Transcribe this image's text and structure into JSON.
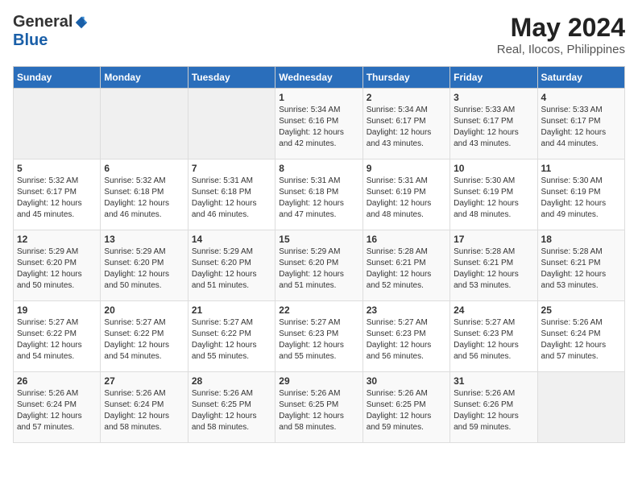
{
  "logo": {
    "general": "General",
    "blue": "Blue"
  },
  "title": "May 2024",
  "location": "Real, Ilocos, Philippines",
  "days_header": [
    "Sunday",
    "Monday",
    "Tuesday",
    "Wednesday",
    "Thursday",
    "Friday",
    "Saturday"
  ],
  "weeks": [
    [
      {
        "num": "",
        "info": ""
      },
      {
        "num": "",
        "info": ""
      },
      {
        "num": "",
        "info": ""
      },
      {
        "num": "1",
        "info": "Sunrise: 5:34 AM\nSunset: 6:16 PM\nDaylight: 12 hours\nand 42 minutes."
      },
      {
        "num": "2",
        "info": "Sunrise: 5:34 AM\nSunset: 6:17 PM\nDaylight: 12 hours\nand 43 minutes."
      },
      {
        "num": "3",
        "info": "Sunrise: 5:33 AM\nSunset: 6:17 PM\nDaylight: 12 hours\nand 43 minutes."
      },
      {
        "num": "4",
        "info": "Sunrise: 5:33 AM\nSunset: 6:17 PM\nDaylight: 12 hours\nand 44 minutes."
      }
    ],
    [
      {
        "num": "5",
        "info": "Sunrise: 5:32 AM\nSunset: 6:17 PM\nDaylight: 12 hours\nand 45 minutes."
      },
      {
        "num": "6",
        "info": "Sunrise: 5:32 AM\nSunset: 6:18 PM\nDaylight: 12 hours\nand 46 minutes."
      },
      {
        "num": "7",
        "info": "Sunrise: 5:31 AM\nSunset: 6:18 PM\nDaylight: 12 hours\nand 46 minutes."
      },
      {
        "num": "8",
        "info": "Sunrise: 5:31 AM\nSunset: 6:18 PM\nDaylight: 12 hours\nand 47 minutes."
      },
      {
        "num": "9",
        "info": "Sunrise: 5:31 AM\nSunset: 6:19 PM\nDaylight: 12 hours\nand 48 minutes."
      },
      {
        "num": "10",
        "info": "Sunrise: 5:30 AM\nSunset: 6:19 PM\nDaylight: 12 hours\nand 48 minutes."
      },
      {
        "num": "11",
        "info": "Sunrise: 5:30 AM\nSunset: 6:19 PM\nDaylight: 12 hours\nand 49 minutes."
      }
    ],
    [
      {
        "num": "12",
        "info": "Sunrise: 5:29 AM\nSunset: 6:20 PM\nDaylight: 12 hours\nand 50 minutes."
      },
      {
        "num": "13",
        "info": "Sunrise: 5:29 AM\nSunset: 6:20 PM\nDaylight: 12 hours\nand 50 minutes."
      },
      {
        "num": "14",
        "info": "Sunrise: 5:29 AM\nSunset: 6:20 PM\nDaylight: 12 hours\nand 51 minutes."
      },
      {
        "num": "15",
        "info": "Sunrise: 5:29 AM\nSunset: 6:20 PM\nDaylight: 12 hours\nand 51 minutes."
      },
      {
        "num": "16",
        "info": "Sunrise: 5:28 AM\nSunset: 6:21 PM\nDaylight: 12 hours\nand 52 minutes."
      },
      {
        "num": "17",
        "info": "Sunrise: 5:28 AM\nSunset: 6:21 PM\nDaylight: 12 hours\nand 53 minutes."
      },
      {
        "num": "18",
        "info": "Sunrise: 5:28 AM\nSunset: 6:21 PM\nDaylight: 12 hours\nand 53 minutes."
      }
    ],
    [
      {
        "num": "19",
        "info": "Sunrise: 5:27 AM\nSunset: 6:22 PM\nDaylight: 12 hours\nand 54 minutes."
      },
      {
        "num": "20",
        "info": "Sunrise: 5:27 AM\nSunset: 6:22 PM\nDaylight: 12 hours\nand 54 minutes."
      },
      {
        "num": "21",
        "info": "Sunrise: 5:27 AM\nSunset: 6:22 PM\nDaylight: 12 hours\nand 55 minutes."
      },
      {
        "num": "22",
        "info": "Sunrise: 5:27 AM\nSunset: 6:23 PM\nDaylight: 12 hours\nand 55 minutes."
      },
      {
        "num": "23",
        "info": "Sunrise: 5:27 AM\nSunset: 6:23 PM\nDaylight: 12 hours\nand 56 minutes."
      },
      {
        "num": "24",
        "info": "Sunrise: 5:27 AM\nSunset: 6:23 PM\nDaylight: 12 hours\nand 56 minutes."
      },
      {
        "num": "25",
        "info": "Sunrise: 5:26 AM\nSunset: 6:24 PM\nDaylight: 12 hours\nand 57 minutes."
      }
    ],
    [
      {
        "num": "26",
        "info": "Sunrise: 5:26 AM\nSunset: 6:24 PM\nDaylight: 12 hours\nand 57 minutes."
      },
      {
        "num": "27",
        "info": "Sunrise: 5:26 AM\nSunset: 6:24 PM\nDaylight: 12 hours\nand 58 minutes."
      },
      {
        "num": "28",
        "info": "Sunrise: 5:26 AM\nSunset: 6:25 PM\nDaylight: 12 hours\nand 58 minutes."
      },
      {
        "num": "29",
        "info": "Sunrise: 5:26 AM\nSunset: 6:25 PM\nDaylight: 12 hours\nand 58 minutes."
      },
      {
        "num": "30",
        "info": "Sunrise: 5:26 AM\nSunset: 6:25 PM\nDaylight: 12 hours\nand 59 minutes."
      },
      {
        "num": "31",
        "info": "Sunrise: 5:26 AM\nSunset: 6:26 PM\nDaylight: 12 hours\nand 59 minutes."
      },
      {
        "num": "",
        "info": ""
      }
    ]
  ]
}
